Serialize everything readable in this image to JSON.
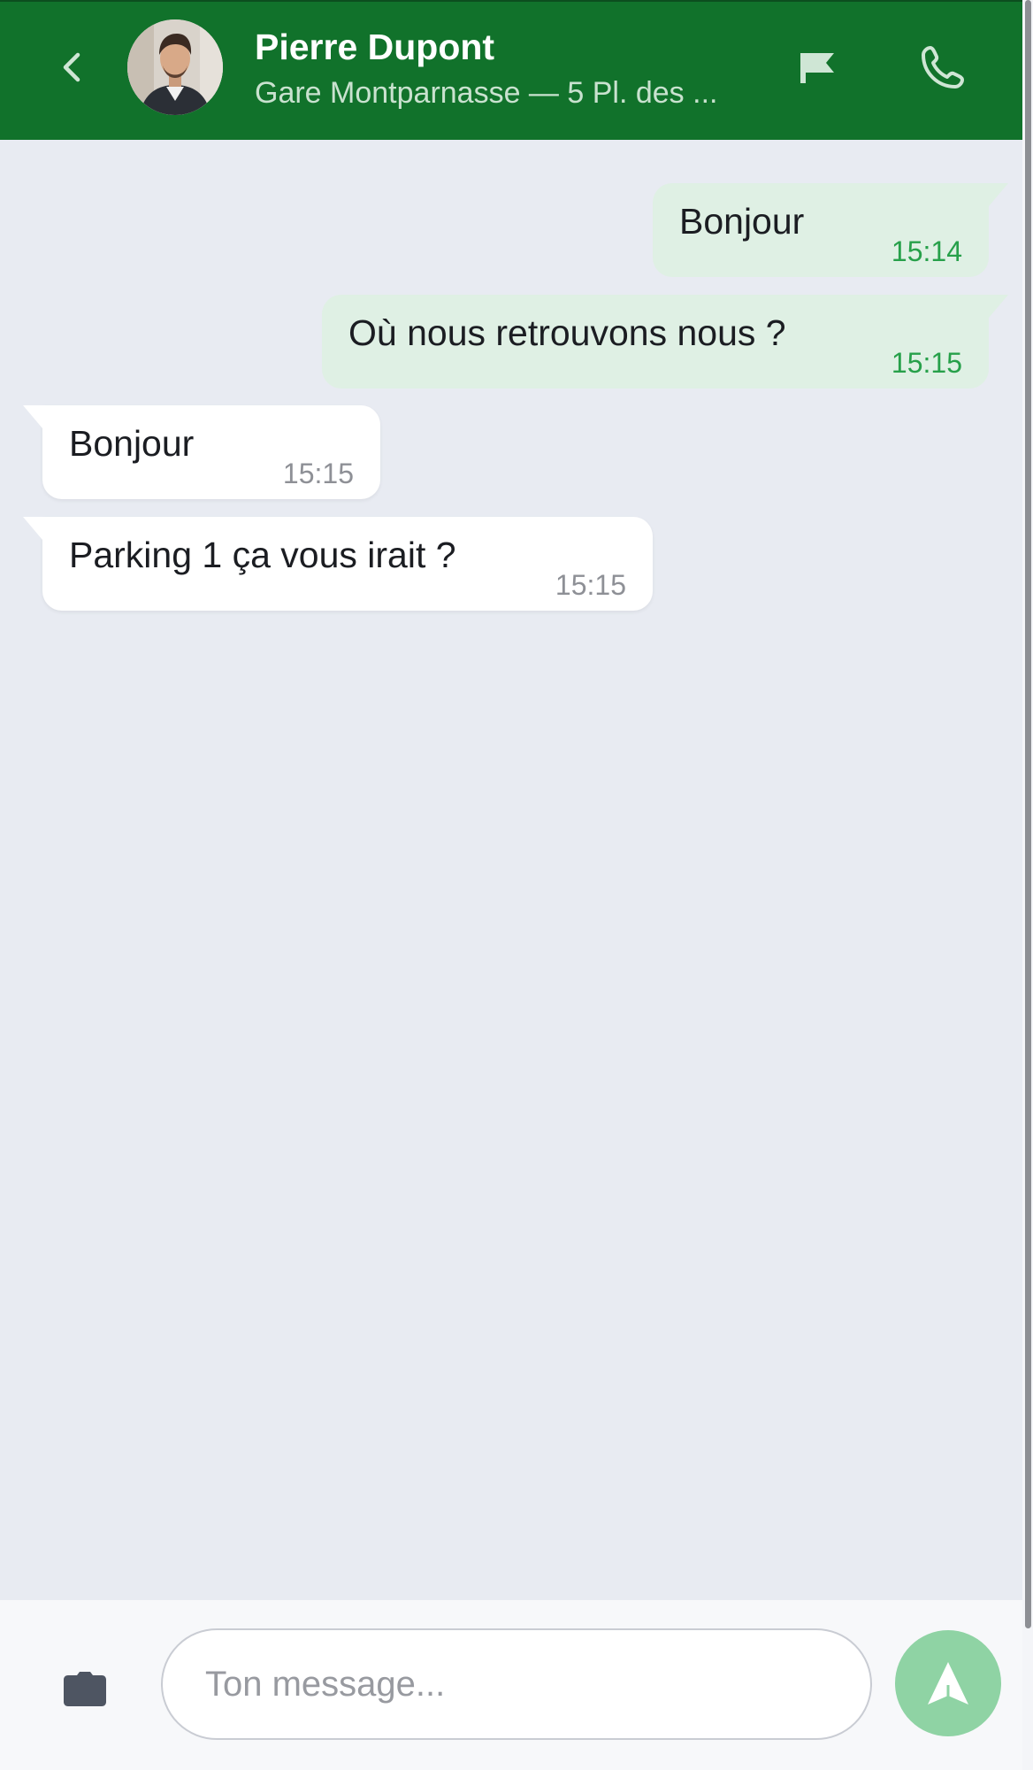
{
  "header": {
    "contact_name": "Pierre Dupont",
    "contact_subtitle": "Gare Montparnasse — 5 Pl. des ...",
    "back_icon": "chevron-left-icon",
    "flag_icon": "flag-icon",
    "phone_icon": "phone-icon",
    "avatar": "contact-avatar"
  },
  "messages": [
    {
      "direction": "outgoing",
      "text": "Bonjour",
      "time": "15:14"
    },
    {
      "direction": "outgoing",
      "text": "Où nous retrouvons nous ?",
      "time": "15:15"
    },
    {
      "direction": "incoming",
      "text": "Bonjour",
      "time": "15:15"
    },
    {
      "direction": "incoming",
      "text": "Parking 1 ça vous irait ?",
      "time": "15:15"
    }
  ],
  "composer": {
    "placeholder": "Ton message...",
    "value": "",
    "camera_icon": "camera-icon",
    "send_icon": "send-icon"
  },
  "colors": {
    "header_bg": "#11722b",
    "chat_bg": "#e8ebf2",
    "outgoing_bubble": "#dff0e4",
    "outgoing_time": "#27a04a",
    "incoming_bubble": "#ffffff",
    "send_button": "#8fd3a4"
  }
}
